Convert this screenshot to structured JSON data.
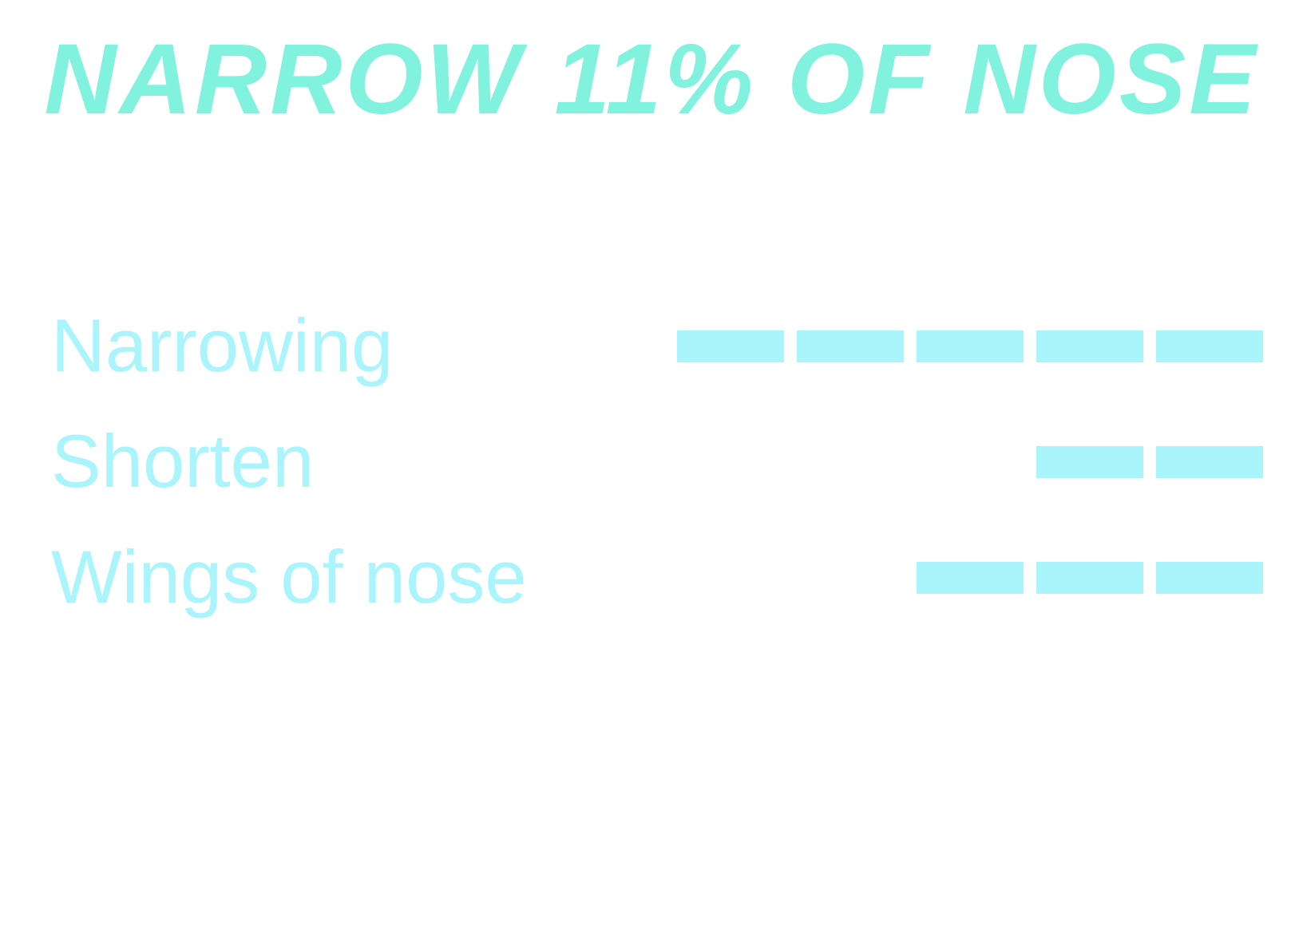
{
  "title": "NARROW 11% OF NOSE",
  "colors": {
    "title": "#80f2dd",
    "label": "#aaf4fb",
    "segment_on": "#aaf4fb",
    "background": "#ffffff"
  },
  "meter_scale": 5,
  "metrics": [
    {
      "label": "Narrowing",
      "level": 5
    },
    {
      "label": "Shorten",
      "level": 2
    },
    {
      "label": "Wings of nose",
      "level": 3
    }
  ]
}
